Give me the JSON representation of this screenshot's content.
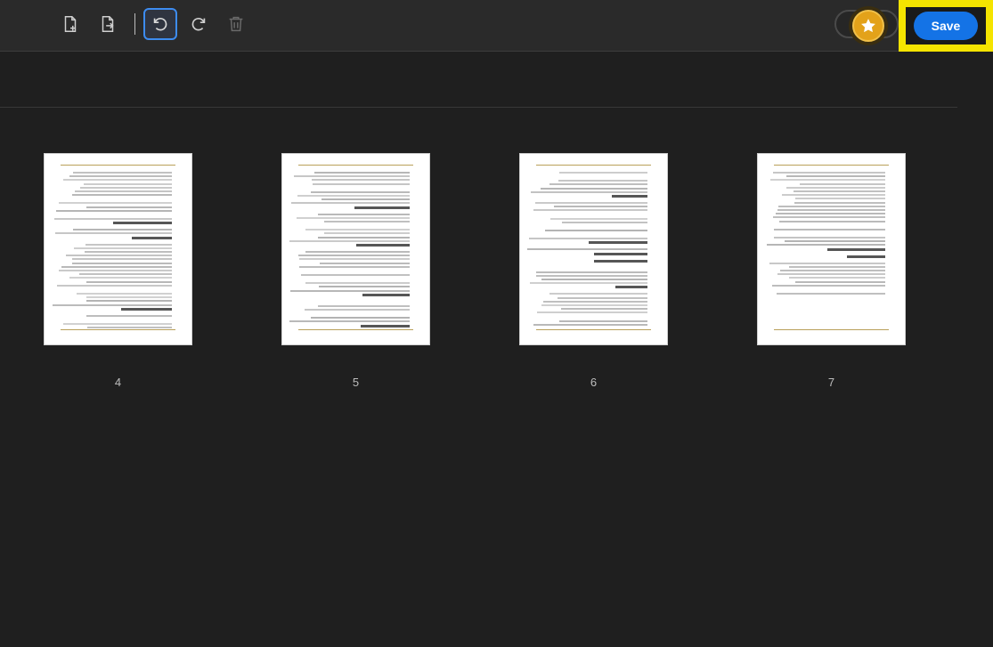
{
  "toolbar": {
    "insert_page_icon": "file-plus-icon",
    "extract_page_icon": "file-export-icon",
    "undo_icon": "undo-icon",
    "redo_icon": "redo-icon",
    "delete_icon": "trash-icon",
    "premium_icon": "star-icon",
    "save_label": "Save"
  },
  "pages": [
    {
      "label": "4"
    },
    {
      "label": "5"
    },
    {
      "label": "6"
    },
    {
      "label": "7"
    }
  ],
  "colors": {
    "accent": "#1473e6",
    "highlight": "#f5e400",
    "premium": "#e3a21a"
  }
}
